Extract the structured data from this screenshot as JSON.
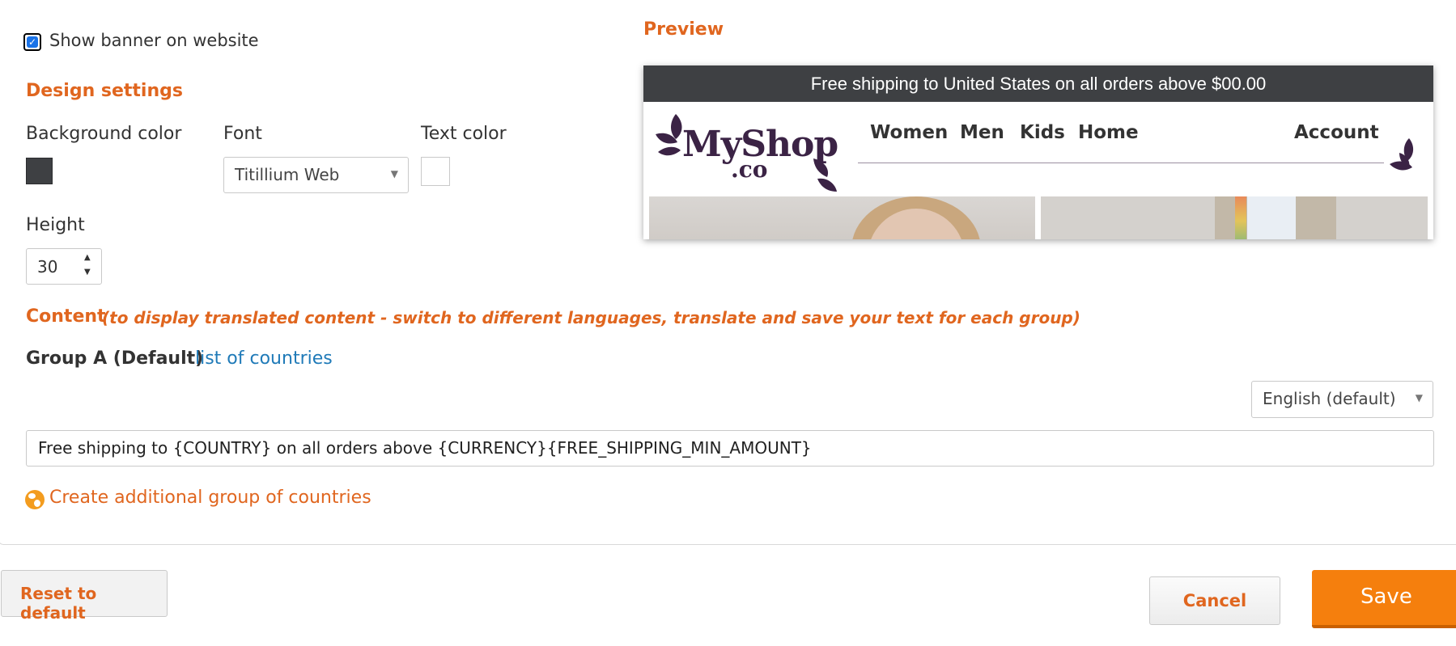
{
  "settings": {
    "show_banner_label": "Show banner on website",
    "show_banner_checked": true,
    "design_title": "Design settings",
    "background_color_label": "Background color",
    "background_color_value": "#3e4043",
    "font_label": "Font",
    "font_value": "Titillium Web",
    "text_color_label": "Text color",
    "text_color_value": "#ffffff",
    "height_label": "Height",
    "height_value": "30"
  },
  "content": {
    "title": "Content",
    "note": "(to display translated content - switch to different languages, translate and save your text for each group)",
    "group_label": "Group A (Default)",
    "countries_link": "list of countries",
    "language_value": "English (default)",
    "banner_text_value": "Free shipping to {COUNTRY} on all orders above {CURRENCY}{FREE_SHIPPING_MIN_AMOUNT}",
    "create_group_link": "Create additional group of countries"
  },
  "preview": {
    "title": "Preview",
    "banner_text": "Free shipping to United States on all orders above $00.00",
    "logo_main": "MyShop",
    "logo_sub": ".co",
    "nav": [
      "Women",
      "Men",
      "Kids",
      "Home",
      "Account"
    ]
  },
  "actions": {
    "reset_label": "Reset to default",
    "cancel_label": "Cancel",
    "save_label": "Save"
  },
  "colors": {
    "accent": "#e0661f",
    "save_button": "#f57f0d",
    "link": "#1f7ab8",
    "banner_bg": "#3e4043"
  }
}
